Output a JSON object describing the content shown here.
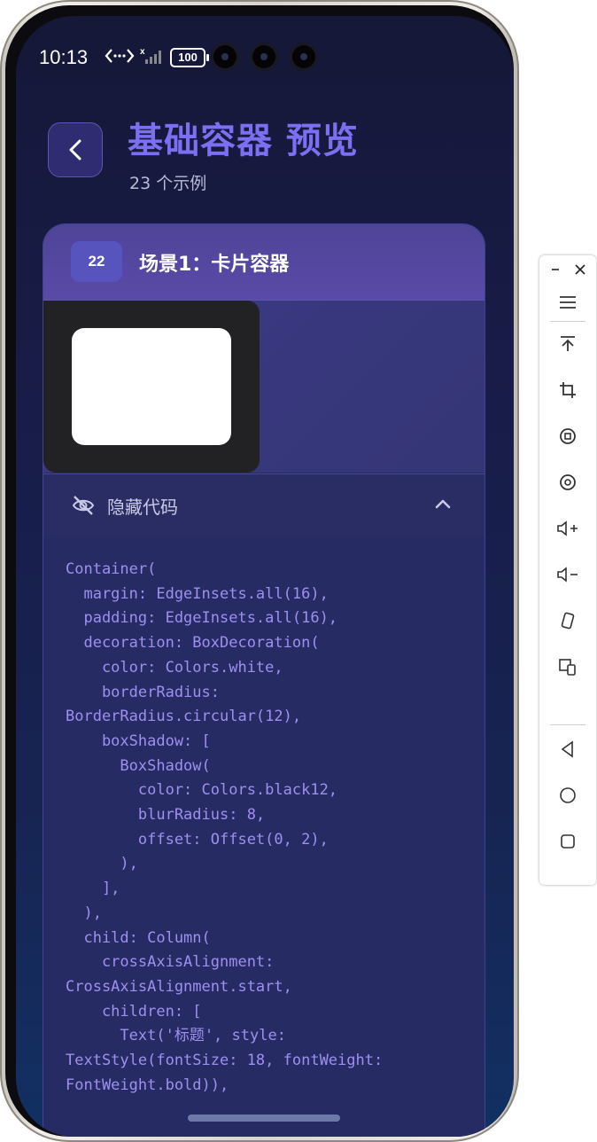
{
  "status_bar": {
    "time": "10:13",
    "battery": "100"
  },
  "header": {
    "title": "基础容器 预览",
    "subtitle": "23 个示例"
  },
  "card": {
    "badge": "22",
    "scene_title": "场景1：卡片容器",
    "toggle_label": "隐藏代码",
    "code": "Container(\n  margin: EdgeInsets.all(16),\n  padding: EdgeInsets.all(16),\n  decoration: BoxDecoration(\n    color: Colors.white,\n    borderRadius:\nBorderRadius.circular(12),\n    boxShadow: [\n      BoxShadow(\n        color: Colors.black12,\n        blurRadius: 8,\n        offset: Offset(0, 2),\n      ),\n    ],\n  ),\n  child: Column(\n    crossAxisAlignment:\nCrossAxisAlignment.start,\n    children: [\n      Text('标题', style:\nTextStyle(fontSize: 18, fontWeight:\nFontWeight.bold)),"
  },
  "colors": {
    "accent": "#7c6ff2",
    "code_text": "#9f8ff0",
    "card_header": "#5a4aa8"
  },
  "toolbar_icons": [
    "minimize-icon",
    "close-icon",
    "menu-icon",
    "pin-top-icon",
    "crop-icon",
    "rotate-left-icon",
    "rotate-right-icon",
    "volume-up-icon",
    "volume-down-icon",
    "shake-icon",
    "multi-device-icon",
    "back-nav-icon",
    "home-nav-icon",
    "recents-nav-icon"
  ]
}
